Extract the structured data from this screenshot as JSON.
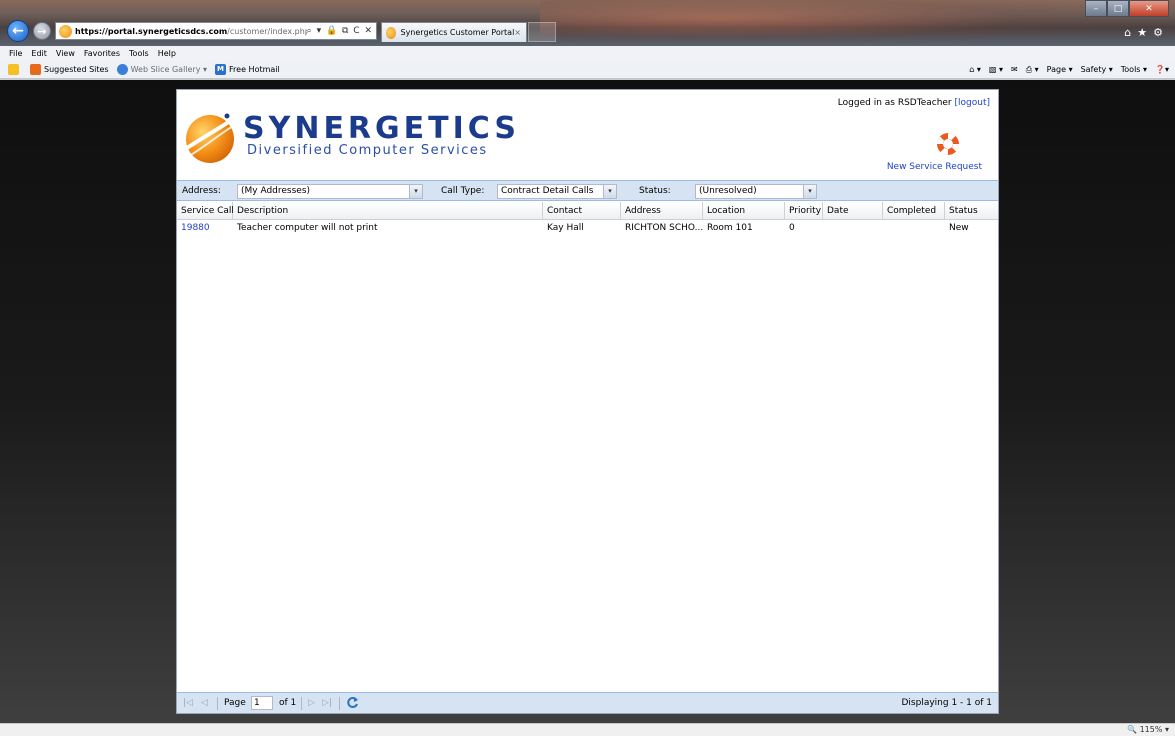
{
  "browser": {
    "url_domain": "https://portal.synergeticsdcs.com",
    "url_path": "/customer/index.php",
    "address_icons": "⌕ ▾ 🔒 ⧉ C ✕",
    "tab_title": "Synergetics Customer Portal",
    "tab_close": "×",
    "menu": [
      "File",
      "Edit",
      "View",
      "Favorites",
      "Tools",
      "Help"
    ],
    "favorites": {
      "suggested": "Suggested Sites",
      "webslice": "Web Slice Gallery ▾",
      "hotmail": "Free Hotmail"
    },
    "commands": [
      "Page ▾",
      "Safety ▾",
      "Tools ▾"
    ],
    "zoom": "115%"
  },
  "portal": {
    "logo_name": "SYNERGETICS",
    "logo_sub": "Diversified Computer Services",
    "logged_in_text": "Logged in as RSDTeacher",
    "logout": "[logout]",
    "new_request": "New Service Request",
    "filters": {
      "address_label": "Address:",
      "address_value": "(My Addresses)",
      "calltype_label": "Call Type:",
      "calltype_value": "Contract Detail Calls",
      "status_label": "Status:",
      "status_value": "(Unresolved)"
    },
    "columns": [
      "Service Call",
      "Description",
      "Contact",
      "Address",
      "Location",
      "Priority",
      "Date",
      "Completed",
      "Status"
    ],
    "rows": [
      {
        "service_call": "19880",
        "description": "Teacher computer will not print",
        "contact": "Kay Hall",
        "address": "RICHTON SCHO...",
        "location": "Room 101",
        "priority": "0",
        "date": "",
        "completed": "",
        "status": "New"
      }
    ],
    "pager": {
      "page_label": "Page",
      "page_value": "1",
      "of_label": "of 1",
      "displaying": "Displaying 1 - 1 of 1"
    }
  }
}
